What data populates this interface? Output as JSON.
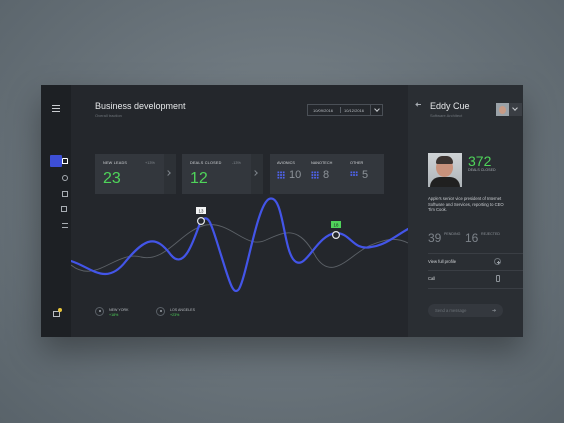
{
  "header": {
    "title": "Business development",
    "subtitle": "Overall traction"
  },
  "date_range": {
    "start": "10/09/2016",
    "end": "10/12/2016"
  },
  "sidebar": {
    "items": [
      "home",
      "compass",
      "square-plus",
      "layers",
      "list"
    ],
    "active": "home"
  },
  "cards": {
    "new_leads": {
      "label": "NEW LEADS",
      "change": "+13%",
      "value": "23"
    },
    "deals_closed": {
      "label": "DEALS CLOSED",
      "change": "-13%",
      "value": "12"
    },
    "categories": [
      {
        "label": "AVIONICS",
        "value": "10"
      },
      {
        "label": "NANOTECH",
        "value": "8"
      },
      {
        "label": "OTHER",
        "value": "5"
      }
    ]
  },
  "chart": {
    "markers": [
      {
        "label": "13"
      },
      {
        "label": "18"
      }
    ],
    "colors": {
      "primary": "#4355e8",
      "secondary": "#5c6167",
      "accent": "#4fd45a"
    }
  },
  "locations": [
    {
      "name": "NEW YORK",
      "change": "+18%"
    },
    {
      "name": "LOS ANGELES",
      "change": "+23%"
    }
  ],
  "profile": {
    "name": "Eddy Cue",
    "role": "Software Architect",
    "deals_value": "372",
    "deals_label": "DEALS CLOSED",
    "bio": "Apple's senior vice president of Internet Software and Services, reporting to CEO Tim Cook.",
    "pending_value": "39",
    "pending_label": "PENDING",
    "rejected_value": "16",
    "rejected_label": "REJECTED",
    "view_profile": "View full profile",
    "call": "Call",
    "message_placeholder": "Send a message"
  }
}
